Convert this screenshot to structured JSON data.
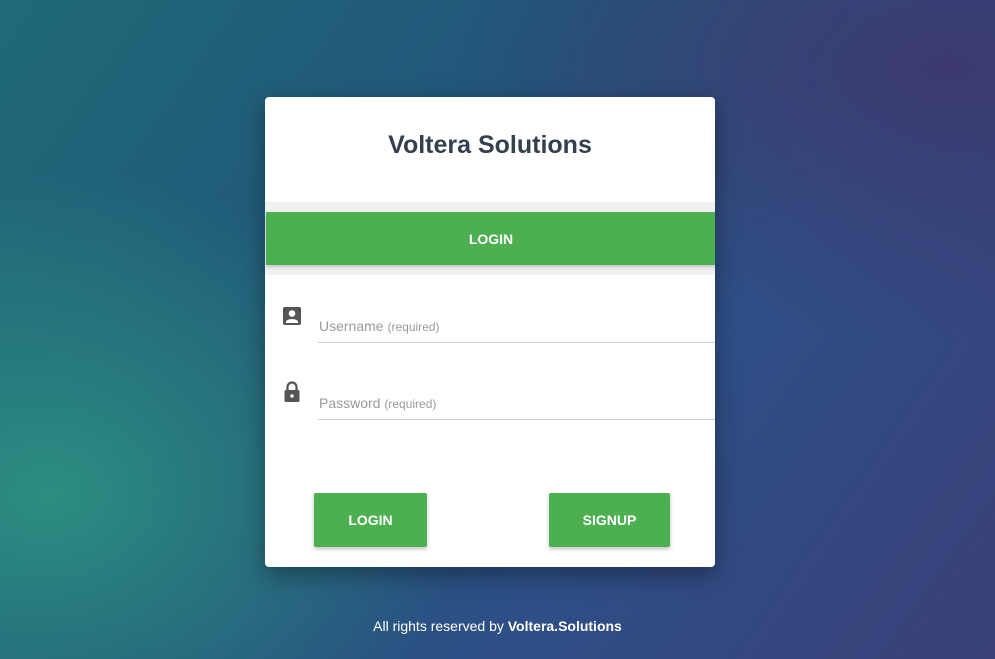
{
  "app": {
    "title": "Voltera Solutions"
  },
  "tabs": {
    "login_label": "LOGIN"
  },
  "form": {
    "username": {
      "placeholder": "Username",
      "hint": "(required)",
      "value": "",
      "icon": "account-box-icon"
    },
    "password": {
      "placeholder": "Password",
      "hint": "(required)",
      "value": "",
      "icon": "lock-icon"
    }
  },
  "actions": {
    "login_label": "LOGIN",
    "signup_label": "SIGNUP"
  },
  "footer": {
    "prefix": "All rights reserved by",
    "brand": "Voltera.Solutions"
  },
  "colors": {
    "accent": "#4caf50",
    "title": "#34404f"
  }
}
